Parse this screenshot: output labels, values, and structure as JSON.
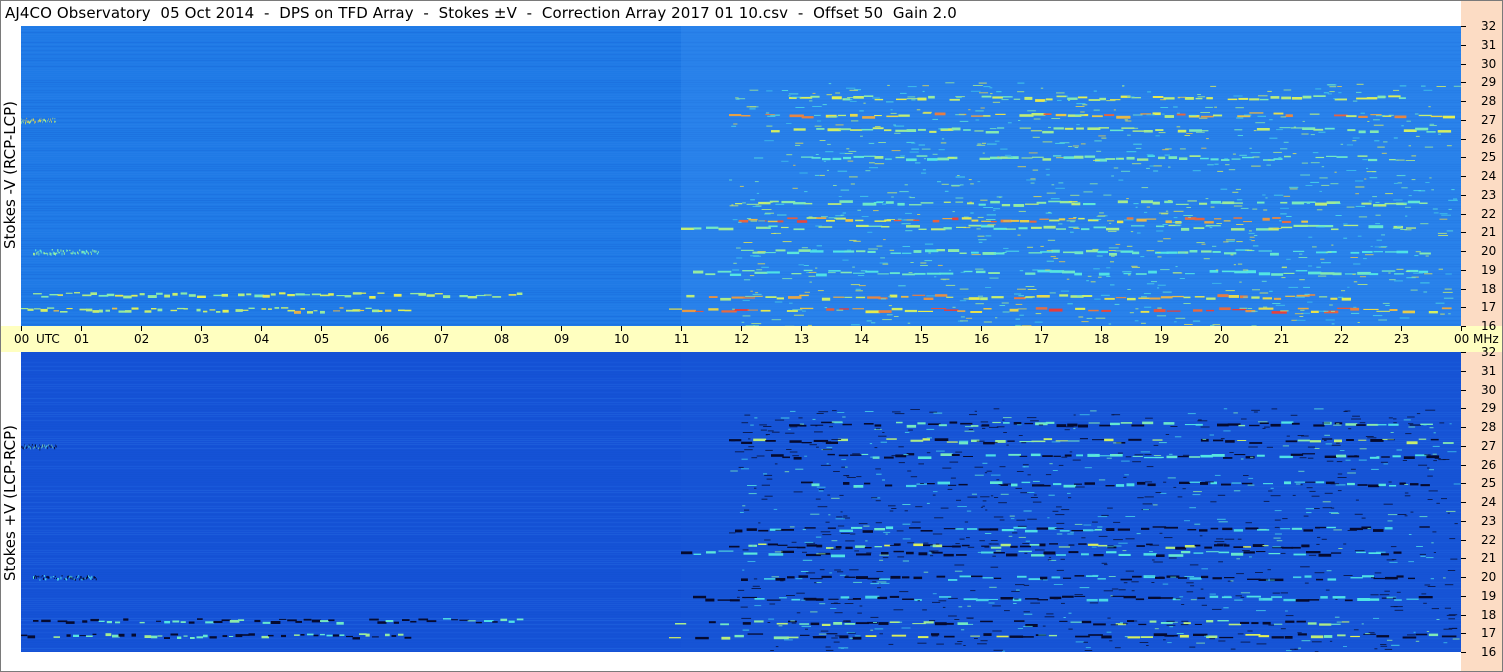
{
  "title": "AJ4CO Observatory  05 Oct 2014  -  DPS on TFD Array  -  Stokes ±V  -  Correction Array 2017 01 10.csv  -  Offset 50  Gain 2.0",
  "chart_data": {
    "type": "heatmap",
    "panels": [
      {
        "ylabel": "Stokes -V (RCP-LCP)",
        "freq_range_mhz": [
          16,
          32
        ],
        "base_color": "#1f7ae6",
        "activity": "bright"
      },
      {
        "ylabel": "Stokes +V (LCP-RCP)",
        "freq_range_mhz": [
          16,
          32
        ],
        "base_color": "#1552d6",
        "activity": "dark"
      }
    ],
    "x_ticks": [
      "00",
      "01",
      "02",
      "03",
      "04",
      "05",
      "06",
      "07",
      "08",
      "09",
      "10",
      "11",
      "12",
      "13",
      "14",
      "15",
      "16",
      "17",
      "18",
      "19",
      "20",
      "21",
      "22",
      "23",
      "00"
    ],
    "x_unit_left": "UTC",
    "x_unit_right": "MHz",
    "x_range_hours": [
      0,
      24
    ],
    "y_ticks": [
      32,
      31,
      30,
      29,
      28,
      27,
      26,
      25,
      24,
      23,
      22,
      21,
      20,
      19,
      18,
      17,
      16
    ],
    "y_range": [
      16,
      32
    ],
    "bands": [
      {
        "f": 27.3,
        "t0": 11.8,
        "t1": 23.9,
        "level": 0.85
      },
      {
        "f": 27.0,
        "t0": 0.0,
        "t1": 0.6,
        "level": 0.7
      },
      {
        "f": 28.2,
        "t0": 12.8,
        "t1": 23.5,
        "level": 0.6
      },
      {
        "f": 26.5,
        "t0": 12.5,
        "t1": 23.8,
        "level": 0.55
      },
      {
        "f": 25.0,
        "t0": 13.0,
        "t1": 23.5,
        "level": 0.45
      },
      {
        "f": 22.6,
        "t0": 11.9,
        "t1": 23.5,
        "level": 0.5
      },
      {
        "f": 21.7,
        "t0": 11.8,
        "t1": 21.5,
        "level": 0.9
      },
      {
        "f": 21.3,
        "t0": 11.0,
        "t1": 23.5,
        "level": 0.5
      },
      {
        "f": 20.0,
        "t0": 0.2,
        "t1": 1.3,
        "level": 0.45
      },
      {
        "f": 20.0,
        "t0": 12.0,
        "t1": 23.5,
        "level": 0.4
      },
      {
        "f": 18.9,
        "t0": 11.2,
        "t1": 23.5,
        "level": 0.4
      },
      {
        "f": 17.7,
        "t0": 0.2,
        "t1": 8.4,
        "level": 0.6
      },
      {
        "f": 17.6,
        "t0": 10.9,
        "t1": 22.2,
        "level": 0.8
      },
      {
        "f": 16.9,
        "t0": 0.0,
        "t1": 6.5,
        "level": 0.7
      },
      {
        "f": 16.9,
        "t0": 10.8,
        "t1": 23.9,
        "level": 0.95
      }
    ]
  }
}
